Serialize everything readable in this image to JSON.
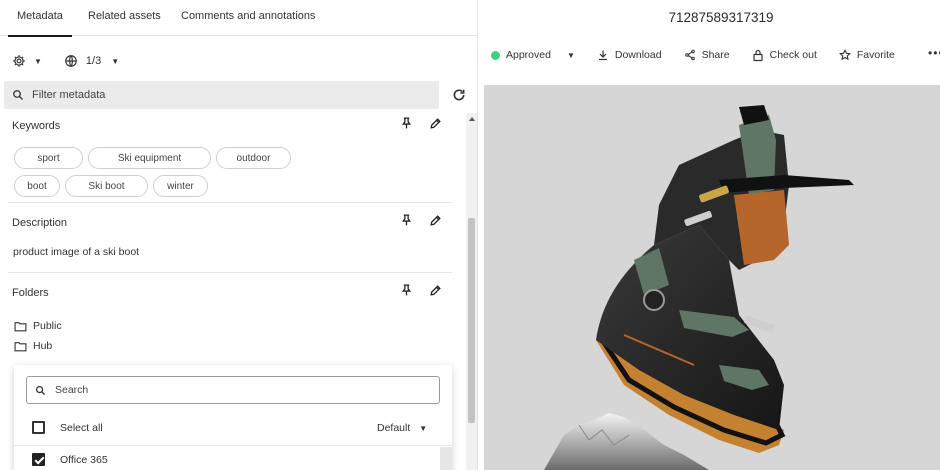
{
  "tabs": [
    {
      "label": "Metadata",
      "active": true
    },
    {
      "label": "Related assets",
      "active": false
    },
    {
      "label": "Comments and annotations",
      "active": false
    }
  ],
  "toolbar": {
    "settings_icon": "gear-icon",
    "language_icon": "globe-icon",
    "language_count": "1/3"
  },
  "filter": {
    "placeholder": "Filter metadata"
  },
  "sections": {
    "keywords": {
      "title": "Keywords",
      "chips": [
        "sport",
        "Ski equipment",
        "outdoor",
        "boot",
        "Ski boot",
        "winter"
      ]
    },
    "description": {
      "title": "Description",
      "value": "product image of a ski boot"
    },
    "folders": {
      "title": "Folders",
      "items": [
        "Public",
        "Hub"
      ]
    }
  },
  "folder_picker": {
    "search_placeholder": "Search",
    "select_all_label": "Select all",
    "default_label": "Default",
    "options": [
      {
        "label": "Office 365",
        "checked": true
      }
    ]
  },
  "asset": {
    "id": "71287589317319",
    "status": {
      "label": "Approved",
      "color": "#3ecf8e"
    },
    "actions": {
      "download": "Download",
      "share": "Share",
      "checkout": "Check out",
      "favorite": "Favorite"
    },
    "preview_background": "#d6d6d6"
  },
  "colors": {
    "accent": "#1a1a1a",
    "chip_border": "#cfcfcf",
    "filter_bg": "#ebebeb"
  }
}
